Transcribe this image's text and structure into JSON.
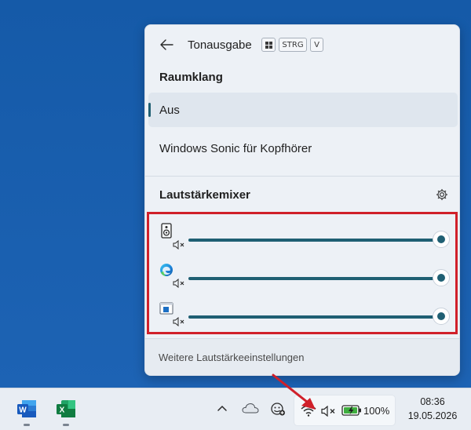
{
  "flyout": {
    "title": "Tonausgabe",
    "shortcut_keys": [
      "STRG",
      "V"
    ],
    "spatial_section_title": "Raumklang",
    "spatial_options": [
      {
        "label": "Aus",
        "selected": true
      },
      {
        "label": "Windows Sonic für Kopfhörer",
        "selected": false
      }
    ],
    "mixer_title": "Lautstärkemixer",
    "mixer_rows": [
      {
        "icon": "speaker-device-icon",
        "muted": true,
        "level": 1.0
      },
      {
        "icon": "edge-browser-icon",
        "muted": true,
        "level": 1.0
      },
      {
        "icon": "app-window-icon",
        "muted": true,
        "level": 1.0
      }
    ],
    "more_settings_label": "Weitere Lautstärkeeinstellungen"
  },
  "taskbar": {
    "pinned_apps": [
      "word-icon",
      "excel-icon"
    ],
    "battery_percent": "100%",
    "time": "08:36",
    "date": "19.05.2026"
  },
  "colors": {
    "accent": "#1f5f73",
    "highlight_border": "#d0202a",
    "desktop": "#1a5fae"
  }
}
